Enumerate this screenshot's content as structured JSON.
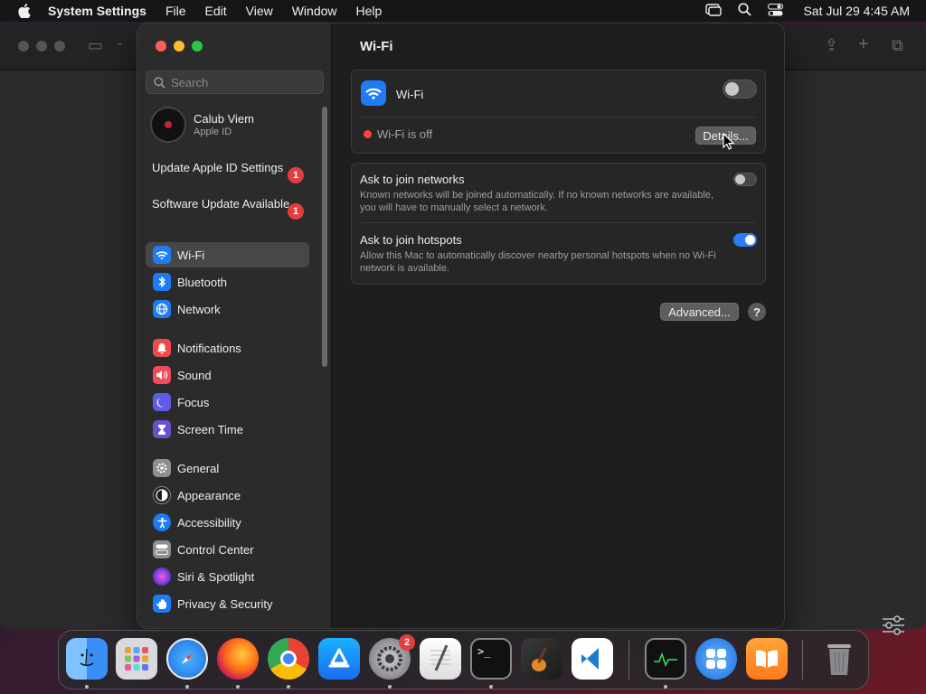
{
  "menubar": {
    "app_name": "System Settings",
    "menus": [
      "File",
      "Edit",
      "View",
      "Window",
      "Help"
    ],
    "clock": "Sat Jul 29  4:45 AM"
  },
  "sidebar": {
    "search_placeholder": "Search",
    "profile": {
      "name": "Calub Viem",
      "subtitle": "Apple ID"
    },
    "notices": [
      {
        "label": "Update Apple ID Settings",
        "badge": "1"
      },
      {
        "label": "Software Update Available",
        "badge": "1"
      }
    ],
    "items": [
      {
        "label": "Wi-Fi",
        "icon": "wifi-icon",
        "color": "#1d7cf4",
        "active": true
      },
      {
        "label": "Bluetooth",
        "icon": "bluetooth-icon",
        "color": "#1d7cf4"
      },
      {
        "label": "Network",
        "icon": "globe-icon",
        "color": "#1d7cf4"
      },
      {
        "label": "Notifications",
        "icon": "bell-icon",
        "color": "#ef4a4a"
      },
      {
        "label": "Sound",
        "icon": "speaker-icon",
        "color": "#ef4a5e"
      },
      {
        "label": "Focus",
        "icon": "moon-icon",
        "color": "#5e5ce6"
      },
      {
        "label": "Screen Time",
        "icon": "hourglass-icon",
        "color": "#6a4fcf"
      },
      {
        "label": "General",
        "icon": "gear-icon",
        "color": "#8e8e93"
      },
      {
        "label": "Appearance",
        "icon": "appearance-icon",
        "color": "#1c1c1e"
      },
      {
        "label": "Accessibility",
        "icon": "accessibility-icon",
        "color": "#1d7cf4"
      },
      {
        "label": "Control Center",
        "icon": "control-center-icon",
        "color": "#8e8e93"
      },
      {
        "label": "Siri & Spotlight",
        "icon": "siri-icon",
        "color": "#b04ad0"
      },
      {
        "label": "Privacy & Security",
        "icon": "hand-icon",
        "color": "#1d7cf4"
      }
    ]
  },
  "main": {
    "title": "Wi-Fi",
    "wifi_row": {
      "label": "Wi-Fi",
      "enabled": false
    },
    "status_text": "Wi-Fi is off",
    "details_button": "Details...",
    "ask_networks": {
      "title": "Ask to join networks",
      "desc": "Known networks will be joined automatically. If no known networks are available, you will have to manually select a network.",
      "enabled": false
    },
    "ask_hotspots": {
      "title": "Ask to join hotspots",
      "desc": "Allow this Mac to automatically discover nearby personal hotspots when no Wi-Fi network is available.",
      "enabled": true
    },
    "advanced_button": "Advanced...",
    "help_button": "?"
  },
  "dock": {
    "apps": [
      "Finder",
      "Launchpad",
      "Safari",
      "Firefox",
      "Chrome",
      "App Store",
      "System Settings",
      "TextEdit",
      "Terminal",
      "GarageBand",
      "Visual Studio Code",
      "Activity Monitor",
      "Mosaic",
      "Books",
      "Trash"
    ],
    "system_settings_badge": "2"
  }
}
